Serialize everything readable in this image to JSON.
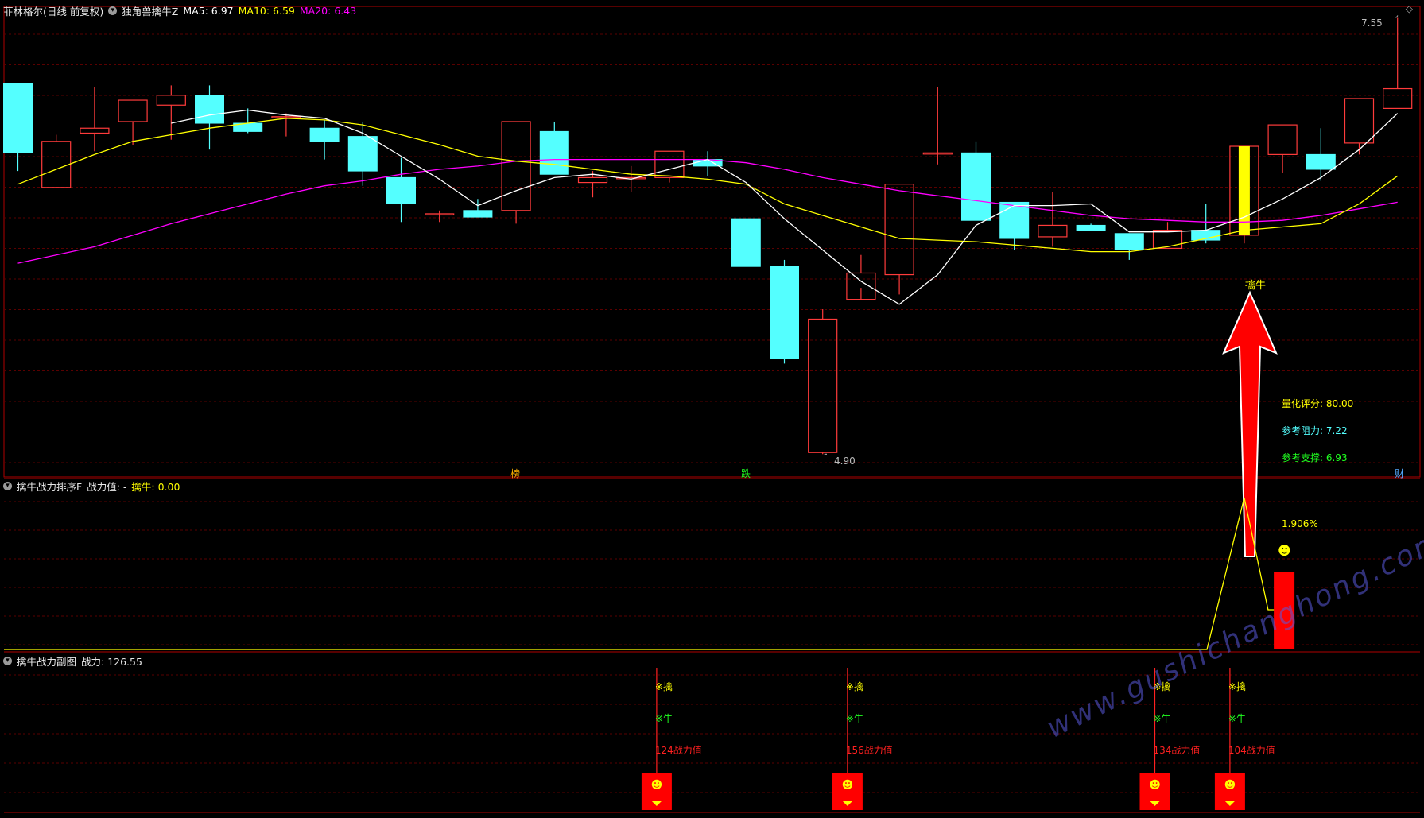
{
  "colors": {
    "bg": "#000000",
    "panel_border": "#b00000",
    "grid": "#5a0000",
    "up": "#ff3b3b",
    "down": "#54ffff",
    "ma5": "#ffffff",
    "ma10": "#ffff00",
    "ma20": "#ff00ff",
    "signal": "#ffff00",
    "green": "#20ff20",
    "red_bar": "#ff0000"
  },
  "main_header": {
    "stock": "菲林格尔(日线 前复权)",
    "indicator": "独角兽擒牛Z",
    "ma5": "MA5: 6.97",
    "ma10": "MA10: 6.59",
    "ma20": "MA20: 6.43"
  },
  "annotations": {
    "high_label": "7.55",
    "low_label": "4.90",
    "signal_label": "擒牛",
    "score": "量化评分: 80.00",
    "resistance": "参考阻力: 7.22",
    "support": "参考支撑: 6.93",
    "mark_bang": "榜",
    "mark_die": "跌",
    "mark_cai": "财",
    "top_right_icon": "◇"
  },
  "panel2_header": {
    "title": "擒牛战力排序F",
    "label": "战力值: -",
    "qin_label": "擒牛: 0.00"
  },
  "panel2": {
    "pct_label": "1.906%",
    "smiley": "☻"
  },
  "panel3_header": {
    "title": "擒牛战力副图",
    "value": "战力: 126.55"
  },
  "panel3": {
    "qin_text": "※擒",
    "niu_text": "※牛",
    "signals": [
      {
        "index": 17,
        "power": "124战力值"
      },
      {
        "index": 22,
        "power": "156战力值"
      },
      {
        "index": 30,
        "power": "134战力值"
      },
      {
        "index": 32,
        "power": "104战力值"
      }
    ]
  },
  "watermark": "www.gushichanghong.com",
  "chart_data": {
    "type": "candlestick",
    "title": "菲林格尔(日线 前复权)",
    "ylim": [
      4.8,
      7.62
    ],
    "series_candles": [
      {
        "o": 7.15,
        "c": 6.73,
        "h": 7.15,
        "l": 6.62
      },
      {
        "o": 6.52,
        "c": 6.8,
        "h": 6.84,
        "l": 6.52
      },
      {
        "o": 6.85,
        "c": 6.88,
        "h": 7.13,
        "l": 6.74
      },
      {
        "o": 6.92,
        "c": 7.05,
        "h": 7.05,
        "l": 6.78
      },
      {
        "o": 7.02,
        "c": 7.08,
        "h": 7.14,
        "l": 6.81
      },
      {
        "o": 7.08,
        "c": 6.91,
        "h": 7.14,
        "l": 6.75
      },
      {
        "o": 6.91,
        "c": 6.86,
        "h": 7.0,
        "l": 6.85
      },
      {
        "o": 6.95,
        "c": 6.95,
        "h": 6.97,
        "l": 6.83
      },
      {
        "o": 6.88,
        "c": 6.8,
        "h": 6.93,
        "l": 6.69
      },
      {
        "o": 6.83,
        "c": 6.62,
        "h": 6.92,
        "l": 6.53
      },
      {
        "o": 6.58,
        "c": 6.42,
        "h": 6.7,
        "l": 6.31
      },
      {
        "o": 6.36,
        "c": 6.36,
        "h": 6.38,
        "l": 6.31
      },
      {
        "o": 6.38,
        "c": 6.34,
        "h": 6.45,
        "l": 6.34
      },
      {
        "o": 6.38,
        "c": 6.92,
        "h": 6.92,
        "l": 6.3
      },
      {
        "o": 6.86,
        "c": 6.6,
        "h": 6.92,
        "l": 6.6
      },
      {
        "o": 6.55,
        "c": 6.58,
        "h": 6.62,
        "l": 6.46
      },
      {
        "o": 6.58,
        "c": 6.58,
        "h": 6.65,
        "l": 6.49
      },
      {
        "o": 6.58,
        "c": 6.74,
        "h": 6.74,
        "l": 6.55
      },
      {
        "o": 6.69,
        "c": 6.65,
        "h": 6.74,
        "l": 6.59
      },
      {
        "o": 6.33,
        "c": 6.04,
        "h": 6.33,
        "l": 6.04
      },
      {
        "o": 6.04,
        "c": 5.48,
        "h": 6.08,
        "l": 5.45
      },
      {
        "o": 4.91,
        "c": 5.72,
        "h": 5.78,
        "l": 4.9
      },
      {
        "o": 5.84,
        "c": 6.0,
        "h": 6.11,
        "l": 5.91
      },
      {
        "o": 5.99,
        "c": 6.54,
        "h": 6.54,
        "l": 5.87
      },
      {
        "o": 6.73,
        "c": 6.73,
        "h": 7.13,
        "l": 6.66
      },
      {
        "o": 6.73,
        "c": 6.32,
        "h": 6.8,
        "l": 6.32
      },
      {
        "o": 6.43,
        "c": 6.21,
        "h": 6.43,
        "l": 6.14
      },
      {
        "o": 6.22,
        "c": 6.29,
        "h": 6.49,
        "l": 6.16
      },
      {
        "o": 6.29,
        "c": 6.26,
        "h": 6.3,
        "l": 6.26
      },
      {
        "o": 6.24,
        "c": 6.14,
        "h": 6.24,
        "l": 6.08
      },
      {
        "o": 6.15,
        "c": 6.26,
        "h": 6.31,
        "l": 6.15
      },
      {
        "o": 6.26,
        "c": 6.2,
        "h": 6.42,
        "l": 6.18
      },
      {
        "o": 6.23,
        "c": 6.77,
        "h": 6.77,
        "l": 6.18
      },
      {
        "o": 6.72,
        "c": 6.9,
        "h": 6.9,
        "l": 6.61
      },
      {
        "o": 6.72,
        "c": 6.63,
        "h": 6.88,
        "l": 6.56
      },
      {
        "o": 6.79,
        "c": 7.06,
        "h": 7.06,
        "l": 6.72
      },
      {
        "o": 7.0,
        "c": 7.12,
        "h": 7.55,
        "l": 7.0
      }
    ],
    "ma5": [
      null,
      null,
      null,
      null,
      6.91,
      6.96,
      6.99,
      6.96,
      6.94,
      6.85,
      6.71,
      6.57,
      6.41,
      6.5,
      6.58,
      6.6,
      6.57,
      6.63,
      6.69,
      6.55,
      6.33,
      6.14,
      5.95,
      5.81,
      5.99,
      6.29,
      6.41,
      6.41,
      6.42,
      6.25,
      6.25,
      6.26,
      6.34,
      6.45,
      6.58,
      6.75,
      6.97
    ],
    "ma10": [
      6.54,
      6.63,
      6.72,
      6.8,
      6.84,
      6.88,
      6.91,
      6.94,
      6.93,
      6.9,
      6.84,
      6.78,
      6.71,
      6.68,
      6.66,
      6.63,
      6.6,
      6.59,
      6.57,
      6.54,
      6.42,
      6.35,
      6.28,
      6.21,
      6.2,
      6.19,
      6.17,
      6.15,
      6.13,
      6.13,
      6.16,
      6.21,
      6.26,
      6.28,
      6.3,
      6.42,
      6.59
    ],
    "ma20": [
      6.06,
      6.11,
      6.16,
      6.23,
      6.3,
      6.36,
      6.42,
      6.48,
      6.53,
      6.56,
      6.6,
      6.63,
      6.65,
      6.68,
      6.69,
      6.69,
      6.69,
      6.69,
      6.69,
      6.67,
      6.63,
      6.58,
      6.54,
      6.5,
      6.47,
      6.44,
      6.41,
      6.38,
      6.35,
      6.33,
      6.32,
      6.31,
      6.31,
      6.32,
      6.35,
      6.39,
      6.43
    ],
    "signal_index": 32,
    "panel2_values": {
      "spike_index": 32,
      "bar_index": 33
    }
  }
}
